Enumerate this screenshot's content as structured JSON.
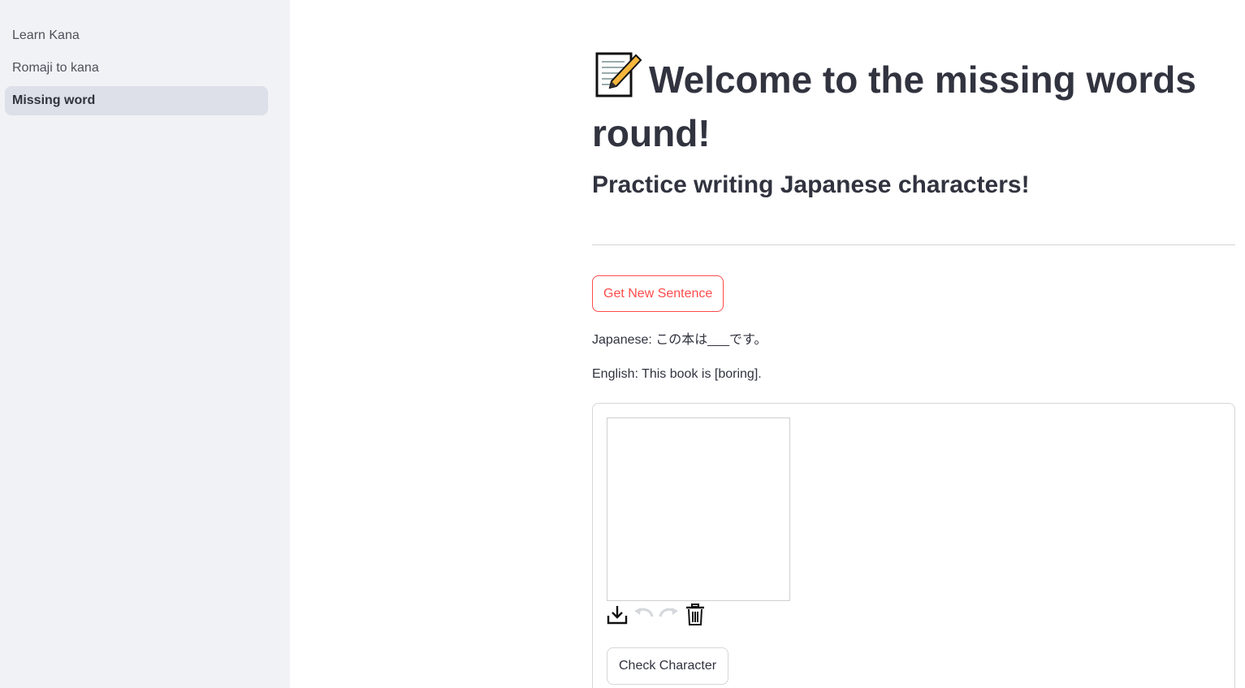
{
  "sidebar": {
    "items": [
      {
        "label": "Learn Kana",
        "active": false
      },
      {
        "label": "Romaji to kana",
        "active": false
      },
      {
        "label": "Missing word",
        "active": true
      }
    ]
  },
  "main": {
    "title": "Welcome to the missing words round!",
    "title_icon": "memo-icon",
    "subtitle": "Practice writing Japanese characters!",
    "new_sentence_button": "Get New Sentence",
    "japanese_line": "Japanese: この本は___です。",
    "english_line": "English: This book is [boring].",
    "canvas_tools": [
      "download-icon",
      "undo-icon",
      "redo-icon",
      "trash-icon"
    ],
    "check_button": "Check Character"
  },
  "colors": {
    "sidebar_bg": "#f0f2f6",
    "active_item_bg": "#dde0e8",
    "accent": "#ff4b4b",
    "text": "#31333f"
  }
}
